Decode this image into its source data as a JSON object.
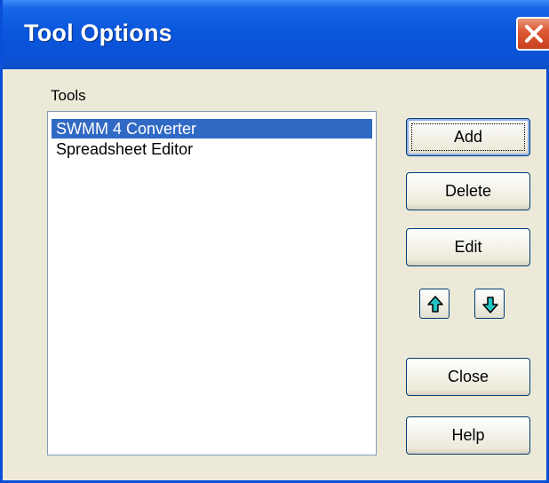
{
  "window": {
    "title": "Tool Options"
  },
  "tools": {
    "label": "Tools",
    "items": [
      {
        "label": "SWMM 4 Converter",
        "selected": true
      },
      {
        "label": "Spreadsheet Editor",
        "selected": false
      }
    ]
  },
  "buttons": {
    "add": "Add",
    "delete": "Delete",
    "edit": "Edit",
    "close": "Close",
    "help": "Help"
  },
  "icons": {
    "close": "close-icon",
    "move_up": "arrow-up-icon",
    "move_down": "arrow-down-icon"
  },
  "colors": {
    "title_bar": "#0a56dc",
    "selection": "#316ac5",
    "arrow_fill": "#22c4c4",
    "close_button": "#dc5a35"
  }
}
